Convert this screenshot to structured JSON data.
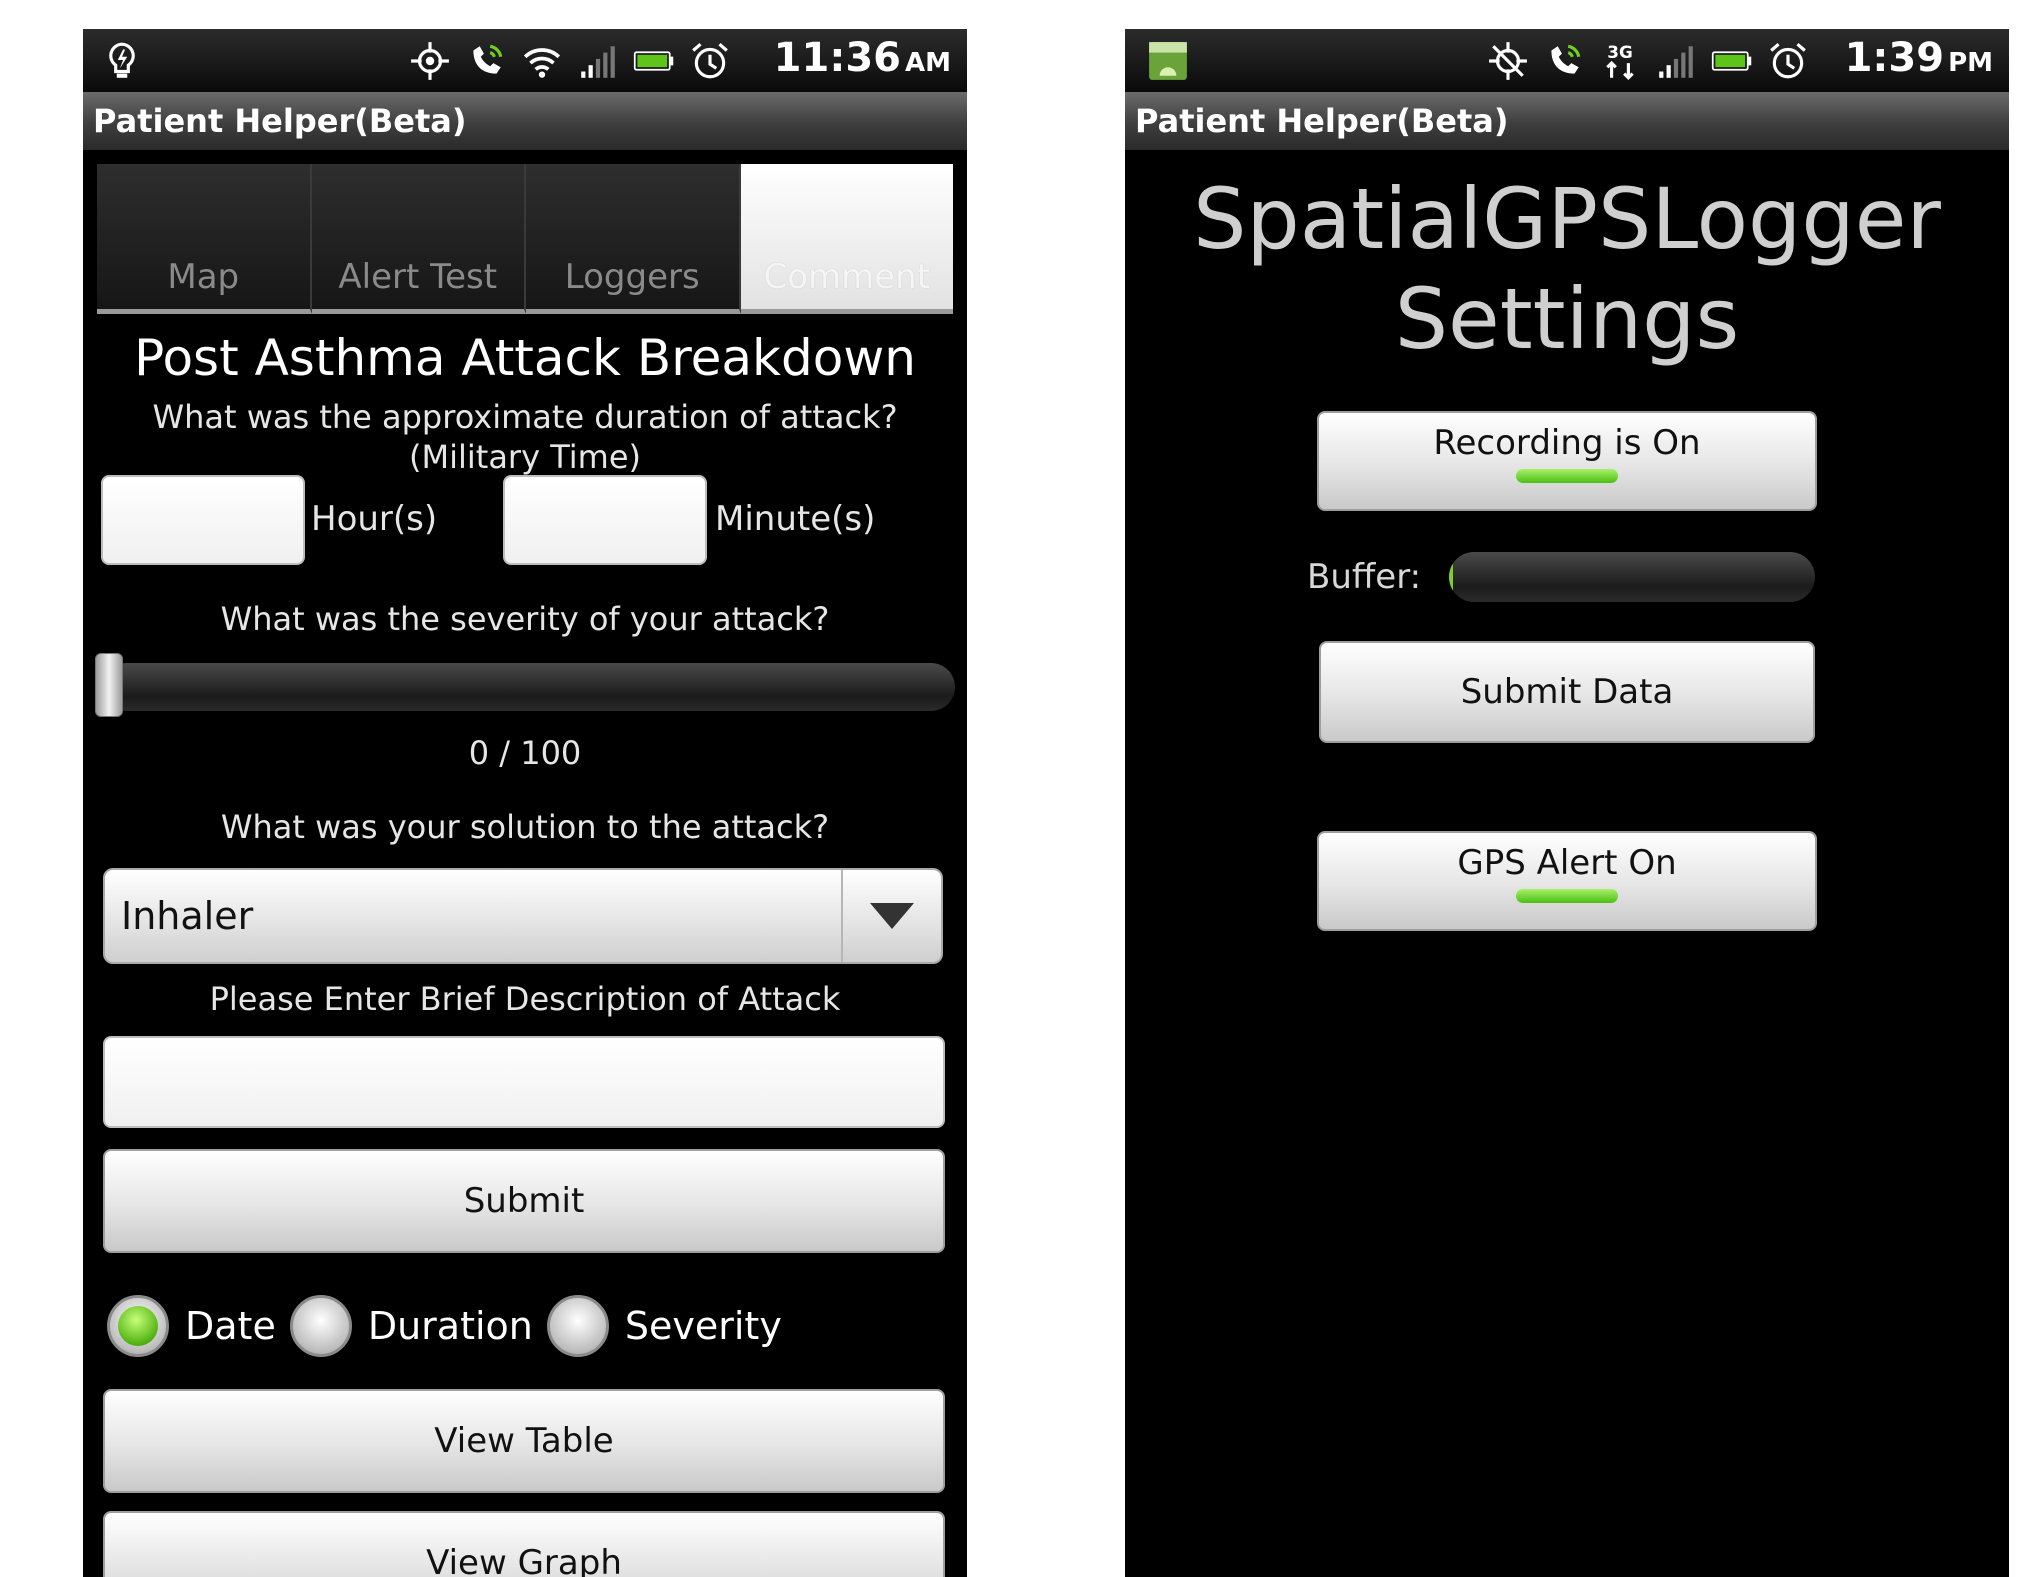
{
  "screen1": {
    "status": {
      "time": "11:36",
      "ampm": "AM",
      "icons_left": [
        "lightbulb-icon"
      ],
      "icons_right": [
        "gps-icon",
        "phone-icon",
        "wifi-icon",
        "signal-icon",
        "battery-icon",
        "alarm-icon"
      ]
    },
    "app_title": "Patient Helper(Beta)",
    "tabs": [
      {
        "label": "Map",
        "active": false
      },
      {
        "label": "Alert Test",
        "active": false
      },
      {
        "label": "Loggers",
        "active": false
      },
      {
        "label": "Comment",
        "active": true
      }
    ],
    "heading": "Post Asthma Attack Breakdown",
    "duration_question": "What was the approximate duration of attack? (Military Time)",
    "hours_value": "",
    "hours_label": "Hour(s)",
    "minutes_value": "",
    "minutes_label": "Minute(s)",
    "severity_question": "What was the severity of your attack?",
    "severity": {
      "value": 0,
      "max": 100,
      "text": "0 / 100"
    },
    "solution_question": "What was your solution to the attack?",
    "solution_selected": "Inhaler",
    "description_label": "Please Enter Brief Description of Attack",
    "description_value": "",
    "submit_label": "Submit",
    "sort_options": [
      {
        "label": "Date",
        "selected": true
      },
      {
        "label": "Duration",
        "selected": false
      },
      {
        "label": "Severity",
        "selected": false
      }
    ],
    "view_table_label": "View Table",
    "view_graph_label": "View Graph"
  },
  "screen2": {
    "status": {
      "time": "1:39",
      "ampm": "PM",
      "icons_left": [
        "sd-card-android-icon"
      ],
      "icons_right": [
        "gps-off-icon",
        "phone-icon",
        "3g-icon",
        "signal-icon",
        "battery-icon",
        "alarm-icon"
      ]
    },
    "app_title": "Patient Helper(Beta)",
    "title_line1": "SpatialGPSLogger",
    "title_line2": "Settings",
    "recording_label": "Recording is On",
    "recording_on": true,
    "buffer_label": "Buffer:",
    "buffer_level": 0.01,
    "submit_data_label": "Submit Data",
    "gps_alert_label": "GPS Alert On",
    "gps_alert_on": true
  },
  "colors": {
    "accent_green": "#7fcf2a",
    "background": "#000000"
  }
}
